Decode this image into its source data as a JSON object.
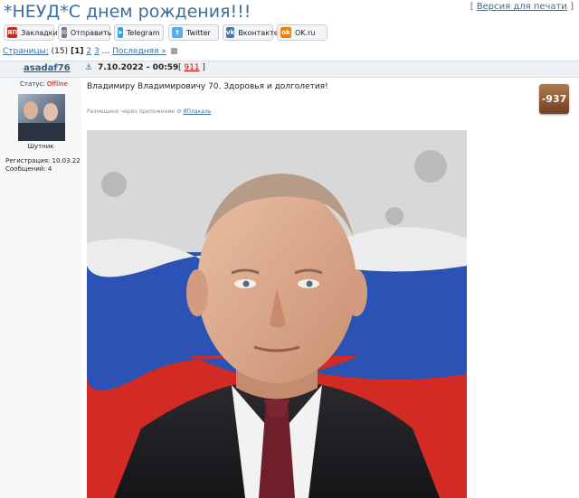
{
  "topic": {
    "title": "*НЕУД*С днем рождения!!!",
    "print_link": "Версия для печати"
  },
  "share": {
    "buttons": [
      {
        "label": "Закладки",
        "color": "#c22b1f",
        "glyph": "ЯП"
      },
      {
        "label": "Отправить",
        "color": "#777777",
        "glyph": "✉"
      },
      {
        "label": "Telegram",
        "color": "#2ca5e0",
        "glyph": "➤"
      },
      {
        "label": "Twitter",
        "color": "#55acee",
        "glyph": "t"
      },
      {
        "label": "Вконтакте",
        "color": "#4a76a8",
        "glyph": "vk"
      },
      {
        "label": "OK.ru",
        "color": "#ee8208",
        "glyph": "ok"
      }
    ]
  },
  "pager": {
    "label": "Страницы:",
    "count": "(15)",
    "current": "[1]",
    "p2": "2",
    "p3": "3",
    "ellipsis": "...",
    "last": "Последняя »"
  },
  "post": {
    "author": "asadaf76",
    "anchor": "⚓",
    "date": "7.10.2022 - 00:59",
    "number": "911",
    "status_label": "Статус:",
    "status_value": "Offline",
    "rank": "Шутник",
    "registration": "Регистрация: 10.03.22",
    "messages": "Сообщений: 4",
    "text": "Владимиру Владимировичу 70. Здоровья и долголетия!",
    "via_prefix": "Размещено через приложение",
    "via_app": "ЯПлакаль",
    "rating": "-937"
  },
  "colors": {
    "link": "#3b6e9e",
    "header_bg": "#eef1f4",
    "offline": "#cc0000"
  }
}
